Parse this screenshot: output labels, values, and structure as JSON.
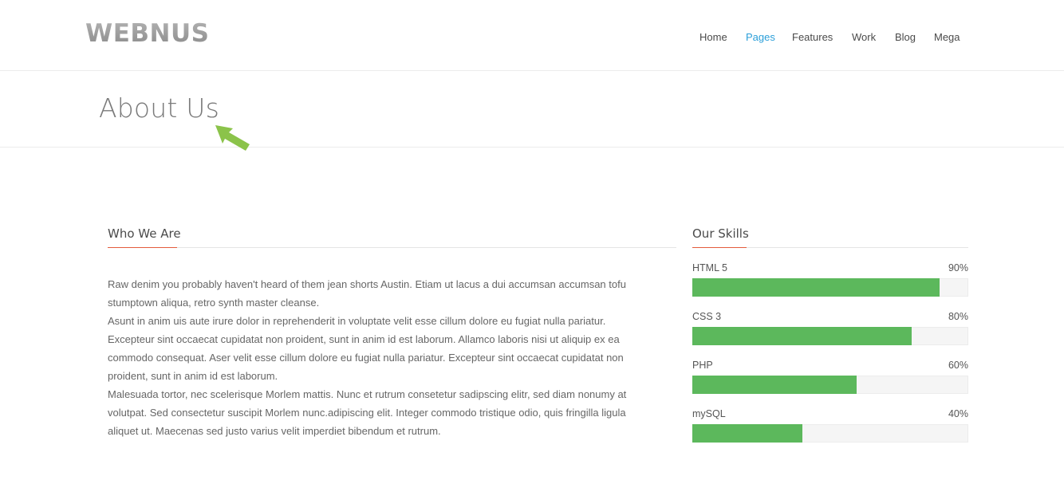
{
  "brand": {
    "logo": "WEBNUS"
  },
  "nav": {
    "items": [
      {
        "label": "Home",
        "active": false
      },
      {
        "label": "Pages",
        "active": true
      },
      {
        "label": "Features",
        "active": false
      },
      {
        "label": "Work",
        "active": false
      },
      {
        "label": "Blog",
        "active": false
      },
      {
        "label": "Mega",
        "active": false
      }
    ]
  },
  "page": {
    "title": "About Us",
    "annotation_arrow": "arrow-icon",
    "arrow_color": "#8bc34a"
  },
  "who": {
    "heading": "Who We Are",
    "paragraphs": [
      "Raw denim you probably haven't heard of them jean shorts Austin. Etiam ut lacus a dui accumsan accumsan tofu stumptown aliqua, retro synth master cleanse.",
      "Asunt in anim uis aute irure dolor in reprehenderit in voluptate velit esse cillum dolore eu fugiat nulla pariatur. Excepteur sint occaecat cupidatat non proident, sunt in anim id est laborum. Allamco laboris nisi ut aliquip ex ea commodo consequat. Aser velit esse cillum dolore eu fugiat nulla pariatur. Excepteur sint occaecat cupidatat non proident, sunt in anim id est laborum.",
      "Malesuada tortor, nec scelerisque Morlem mattis. Nunc et rutrum consetetur sadipscing elitr, sed diam nonumy at volutpat. Sed consectetur suscipit Morlem nunc.adipiscing elit. Integer commodo tristique odio, quis fringilla ligula aliquet ut. Maecenas sed justo varius velit imperdiet bibendum et rutrum."
    ]
  },
  "skills": {
    "heading": "Our Skills",
    "bar_color": "#5cb85c",
    "items": [
      {
        "name": "HTML 5",
        "percent_label": "90%",
        "value": 0.9
      },
      {
        "name": "CSS 3",
        "percent_label": "80%",
        "value": 0.8
      },
      {
        "name": "PHP",
        "percent_label": "60%",
        "value": 0.6
      },
      {
        "name": "mySQL",
        "percent_label": "40%",
        "value": 0.4
      }
    ]
  },
  "colors": {
    "accent_underline": "#e35b3c",
    "nav_active": "#2b9fd9"
  }
}
